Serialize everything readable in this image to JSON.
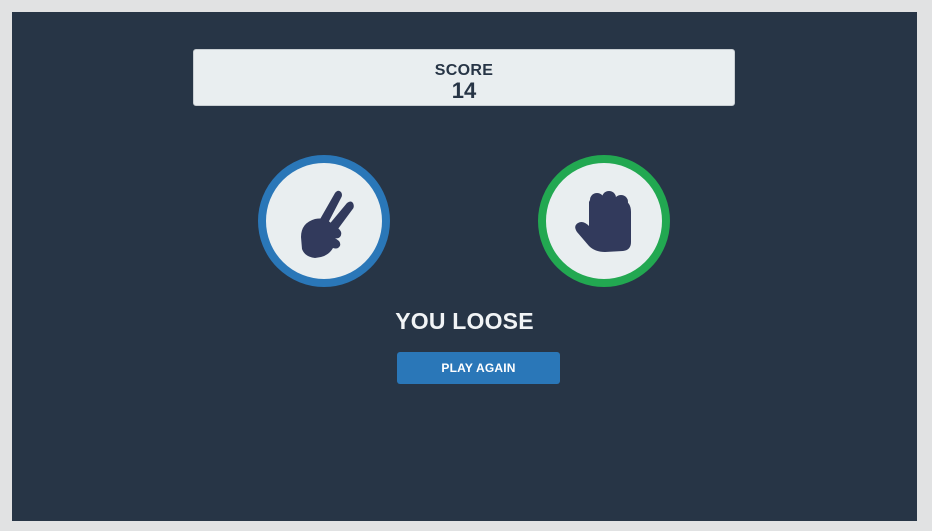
{
  "score": {
    "label": "SCORE",
    "value": "14"
  },
  "player_choice": {
    "icon": "scissors-hand-icon",
    "ring_color": "#2a77b8"
  },
  "house_choice": {
    "icon": "rock-fist-icon",
    "ring_color": "#22a851"
  },
  "result": {
    "text": "YOU LOOSE"
  },
  "actions": {
    "play_again_label": "PLAY AGAIN"
  },
  "colors": {
    "background": "#273546",
    "hand": "#323a5c",
    "panel": "#e9eef0",
    "button": "#2a77b8"
  }
}
